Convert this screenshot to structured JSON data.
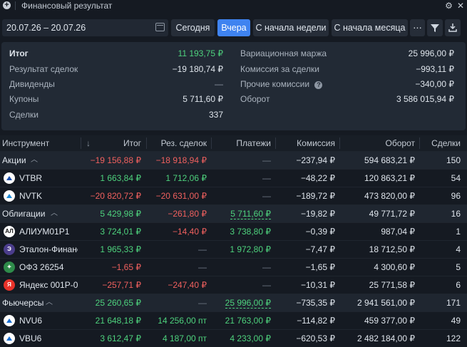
{
  "window": {
    "title": "Финансовый результат"
  },
  "toolbar": {
    "date_range": "20.07.26 – 20.07.26",
    "buttons": [
      "Сегодня",
      "Вчера",
      "С начала недели",
      "С начала месяца"
    ],
    "active": "Вчера"
  },
  "summary": {
    "left": [
      {
        "label": "Итог",
        "value": "11 193,75 ₽"
      },
      {
        "label": "Результат сделок",
        "value": "−19 180,74 ₽"
      },
      {
        "label": "Дивиденды",
        "value": "—"
      },
      {
        "label": "Купоны",
        "value": "5 711,60 ₽"
      },
      {
        "label": "Сделки",
        "value": "337"
      }
    ],
    "right": [
      {
        "label": "Вариационная маржа",
        "value": "25 996,00 ₽"
      },
      {
        "label": "Комиссия за сделки",
        "value": "−993,11 ₽"
      },
      {
        "label": "Прочие комиссии",
        "value": "−340,00 ₽"
      },
      {
        "label": "Оборот",
        "value": "3 586 015,94 ₽"
      }
    ]
  },
  "table": {
    "headers": {
      "instrument": "Инструмент",
      "itog": "Итог",
      "res": "Рез. сделок",
      "pay": "Платежи",
      "com": "Комиссия",
      "obr": "Оборот",
      "deals": "Сделки"
    },
    "rows": [
      {
        "name": "Акции",
        "group": true,
        "itog": "−19 156,88 ₽",
        "res": "−18 918,94 ₽",
        "pay": "—",
        "com": "−237,94 ₽",
        "obr": "594 683,21 ₽",
        "deals": "150"
      },
      {
        "name": "VTBR",
        "icon": "vtbr",
        "itog": "1 663,84 ₽",
        "res": "1 712,06 ₽",
        "pay": "—",
        "com": "−48,22 ₽",
        "obr": "120 863,21 ₽",
        "deals": "54"
      },
      {
        "name": "NVTK",
        "icon": "nvtk",
        "itog": "−20 820,72 ₽",
        "res": "−20 631,00 ₽",
        "pay": "—",
        "com": "−189,72 ₽",
        "obr": "473 820,00 ₽",
        "deals": "96"
      },
      {
        "name": "Облигации",
        "group": true,
        "itog": "5 429,98 ₽",
        "res": "−261,80 ₽",
        "pay": "5 711,60 ₽",
        "com": "−19,82 ₽",
        "obr": "49 771,72 ₽",
        "deals": "16"
      },
      {
        "name": "АЛИУМ01Р1",
        "icon": "alium",
        "itog": "3 724,01 ₽",
        "res": "−14,40 ₽",
        "pay": "3 738,80 ₽",
        "com": "−0,39 ₽",
        "obr": "987,04 ₽",
        "deals": "1"
      },
      {
        "name": "Эталон-Финанс",
        "icon": "etalon",
        "itog": "1 965,33 ₽",
        "res": "—",
        "pay": "1 972,80 ₽",
        "com": "−7,47 ₽",
        "obr": "18 712,50 ₽",
        "deals": "4"
      },
      {
        "name": "ОФЗ 26254",
        "icon": "ofz",
        "itog": "−1,65 ₽",
        "res": "—",
        "pay": "—",
        "com": "−1,65 ₽",
        "obr": "4 300,60 ₽",
        "deals": "5"
      },
      {
        "name": "Яндекс 001Р-0",
        "icon": "yandex",
        "itog": "−257,71 ₽",
        "res": "−247,40 ₽",
        "pay": "—",
        "com": "−10,31 ₽",
        "obr": "25 771,58 ₽",
        "deals": "6"
      },
      {
        "name": "Фьючерсы",
        "group": true,
        "itog": "25 260,65 ₽",
        "res": "—",
        "pay": "25 996,00 ₽",
        "com": "−735,35 ₽",
        "obr": "2 941 561,00 ₽",
        "deals": "171"
      },
      {
        "name": "NVU6",
        "icon": "fut",
        "itog": "21 648,18 ₽",
        "res": "14 256,00 пт",
        "pay": "21 763,00 ₽",
        "com": "−114,82 ₽",
        "obr": "459 377,00 ₽",
        "deals": "49"
      },
      {
        "name": "VBU6",
        "icon": "fut",
        "itog": "3 612,47 ₽",
        "res": "4 187,00 пт",
        "pay": "4 233,00 ₽",
        "com": "−620,53 ₽",
        "obr": "2 482 184,00 ₽",
        "deals": "122"
      }
    ]
  },
  "colors": {
    "accent": "#3f83f0",
    "positive": "#4ed27d",
    "negative": "#f0605e",
    "background": "#151a22",
    "panel": "#222a35"
  }
}
